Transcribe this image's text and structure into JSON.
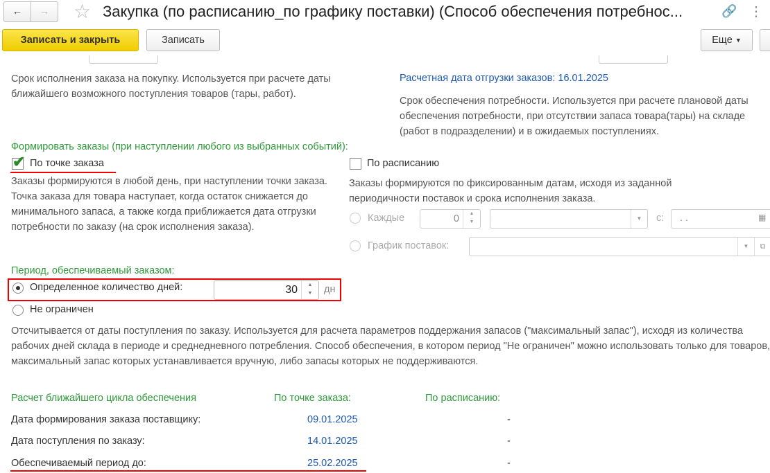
{
  "window": {
    "title": "Закупка (по расписанию_по графику поставки) (Способ обеспечения потребнос..."
  },
  "toolbar": {
    "save_close": "Записать и закрыть",
    "save": "Записать",
    "more": "Еще"
  },
  "top": {
    "lead_desc": "Срок исполнения заказа на покупку. Используется при расчете даты ближайшего возможного поступления товаров (тары, работ).",
    "ship_date_label": "Расчетная дата отгрузки заказов: 16.01.2025",
    "provision_desc": "Срок обеспечения потребности. Используется при расчете плановой даты обеспечения потребности, при отсутствии запаса товара(тары) на складе (работ в подразделении) и в ожидаемых поступлениях."
  },
  "orders": {
    "heading": "Формировать заказы (при наступлении любого из выбранных событий):",
    "by_point": {
      "label": "По точке заказа",
      "checked": true,
      "desc": "Заказы формируются в любой день, при наступлении точки заказа. Точка заказа для товара  наступает, когда остаток снижается до минимального запаса, а также когда приближается дата отгрузки потребности по заказу (на срок исполнения заказа)."
    },
    "by_schedule": {
      "label": "По расписанию",
      "checked": false,
      "desc": "Заказы формируются по фиксированным датам, исходя из заданной периодичности поставок и срока исполнения заказа.",
      "every_label": "Каждые",
      "every_value": "0",
      "period_value": "",
      "from_label": "с:",
      "from_value": " .  .",
      "schedule_label": "График поставок:",
      "schedule_value": ""
    }
  },
  "period": {
    "heading": "Период, обеспечиваемый заказом:",
    "fixed_label": "Определенное количество дней:",
    "fixed_value": "30",
    "unit": "дн",
    "unlimited_label": "Не ограничен",
    "selected": "fixed",
    "desc": "Отсчитывается от даты поступления по заказу. Используется для расчета параметров поддержания запасов (\"максимальный запас\"), исходя из количества рабочих дней склада в периоде и среднедневного потребления. Способ обеспечения, в котором период \"Не ограничен\" можно использовать только для товаров, максимальный запас которых устанавливается вручную, либо запасы которых не поддерживаются."
  },
  "cycle": {
    "heading": "Расчет ближайшего цикла обеспечения",
    "col_point": "По точке заказа:",
    "col_schedule": "По расписанию:",
    "rows": [
      {
        "label": "Дата формирования заказа поставщику:",
        "point": "09.01.2025",
        "schedule": "-"
      },
      {
        "label": "Дата поступления по заказу:",
        "point": "14.01.2025",
        "schedule": "-"
      },
      {
        "label": "Обеспечиваемый период до:",
        "point": "25.02.2025",
        "schedule": "-"
      }
    ]
  }
}
